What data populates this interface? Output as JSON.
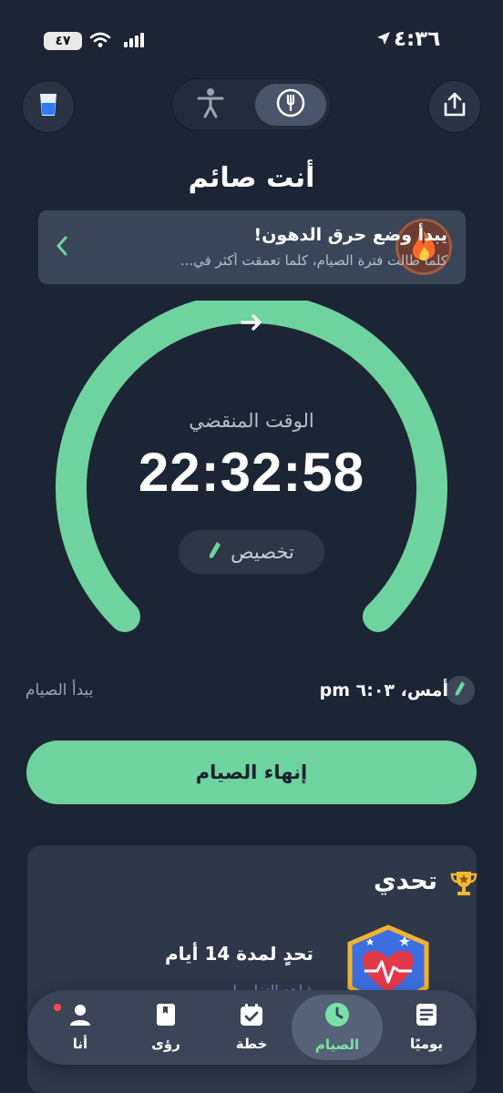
{
  "status": {
    "time": "٤:٣٦",
    "battery": "٤٧"
  },
  "header": {
    "title": "أنت صائم"
  },
  "banner": {
    "title": "يبدأ وضع حرق الدهون!",
    "subtitle": "كلما طالت فترة الصيام، كلما تعمقت أكثر في..."
  },
  "timer": {
    "label": "الوقت المنقضي",
    "value": "22:32:58",
    "customize": "تخصيص"
  },
  "fast_start": {
    "label": "يبدأ الصيام",
    "value": "أمس، ٦:٠٣ pm"
  },
  "end_button": "إنهاء الصيام",
  "challenge": {
    "title": "تحدي",
    "name": "تحدٍ لمدة 14 أيام",
    "link": "شاهد التفاصيل"
  },
  "tabs": [
    {
      "label": "أنا"
    },
    {
      "label": "رؤى"
    },
    {
      "label": "خطة"
    },
    {
      "label": "الصيام"
    },
    {
      "label": "يوميًا"
    }
  ],
  "colors": {
    "background": "#1c2533",
    "accent_green": "#6fd3a0",
    "card": "#2e3849",
    "banner": "#3a4658"
  },
  "icons": {
    "water": "water-glass-icon",
    "body": "person-icon",
    "fast": "plate-utensils-icon",
    "share": "share-icon",
    "fire": "fire-icon",
    "trophy": "trophy-icon"
  }
}
